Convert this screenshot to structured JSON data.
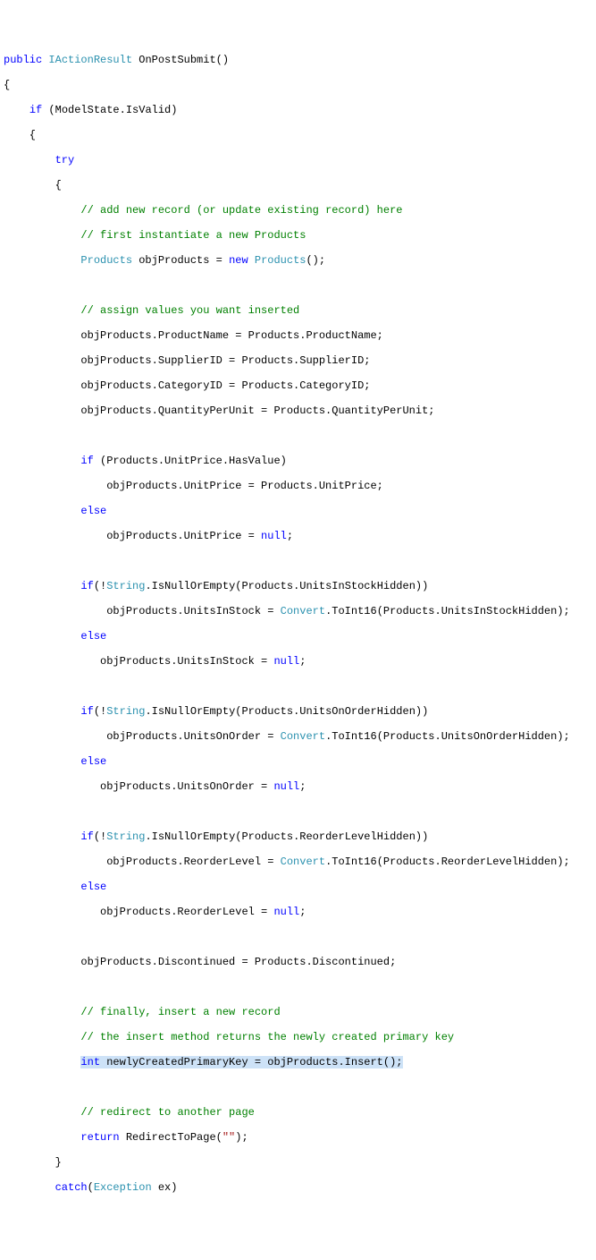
{
  "code": {
    "l1_kw1": "public",
    "l1_type": "IActionResult",
    "l1_rest": " OnPostSubmit()",
    "l2": "{",
    "l3_kw": "if",
    "l3_rest": " (ModelState.IsValid)",
    "l4": "    {",
    "l5_kw": "try",
    "l6": "        {",
    "l7_cmt": "// add new record (or update existing record) here",
    "l8_cmt": "// first instantiate a new Products",
    "l9_type": "Products",
    "l9_mid": " objProducts = ",
    "l9_kw": "new",
    "l9_type2": "Products",
    "l9_end": "();",
    "l10_cmt": "// assign values you want inserted",
    "l11": "            objProducts.ProductName = Products.ProductName;",
    "l12": "            objProducts.SupplierID = Products.SupplierID;",
    "l13": "            objProducts.CategoryID = Products.CategoryID;",
    "l14": "            objProducts.QuantityPerUnit = Products.QuantityPerUnit;",
    "l15_kw": "if",
    "l15_rest": " (Products.UnitPrice.HasValue)",
    "l16": "                objProducts.UnitPrice = Products.UnitPrice;",
    "l17_kw": "else",
    "l18_a": "                objProducts.UnitPrice = ",
    "l18_kw": "null",
    "l18_end": ";",
    "l19_kw": "if",
    "l19_a": "(!",
    "l19_type": "String",
    "l19_b": ".IsNullOrEmpty(Products.UnitsInStockHidden))",
    "l20_a": "                objProducts.UnitsInStock = ",
    "l20_type": "Convert",
    "l20_b": ".ToInt16(Products.UnitsInStockHidden);",
    "l21_kw": "else",
    "l22_a": "               objProducts.UnitsInStock = ",
    "l22_kw": "null",
    "l22_end": ";",
    "l23_kw": "if",
    "l23_a": "(!",
    "l23_type": "String",
    "l23_b": ".IsNullOrEmpty(Products.UnitsOnOrderHidden))",
    "l24_a": "                objProducts.UnitsOnOrder = ",
    "l24_type": "Convert",
    "l24_b": ".ToInt16(Products.UnitsOnOrderHidden);",
    "l25_kw": "else",
    "l26_a": "               objProducts.UnitsOnOrder = ",
    "l26_kw": "null",
    "l26_end": ";",
    "l27_kw": "if",
    "l27_a": "(!",
    "l27_type": "String",
    "l27_b": ".IsNullOrEmpty(Products.ReorderLevelHidden))",
    "l28_a": "                objProducts.ReorderLevel = ",
    "l28_type": "Convert",
    "l28_b": ".ToInt16(Products.ReorderLevelHidden);",
    "l29_kw": "else",
    "l30_a": "               objProducts.ReorderLevel = ",
    "l30_kw": "null",
    "l30_end": ";",
    "l31": "            objProducts.Discontinued = Products.Discontinued;",
    "l32_cmt": "// finally, insert a new record",
    "l33_cmt": "// the insert method returns the newly created primary key",
    "l34_kw": "int",
    "l34_rest": " newlyCreatedPrimaryKey = objProducts.Insert();",
    "l35_cmt": "// redirect to another page",
    "l36_kw": "return",
    "l36_mid": " RedirectToPage(",
    "l36_str": "\"\"",
    "l36_end": ");",
    "l37": "        }",
    "l38_kw": "catch",
    "l38_a": "(",
    "l38_type": "Exception",
    "l38_b": " ex)"
  }
}
